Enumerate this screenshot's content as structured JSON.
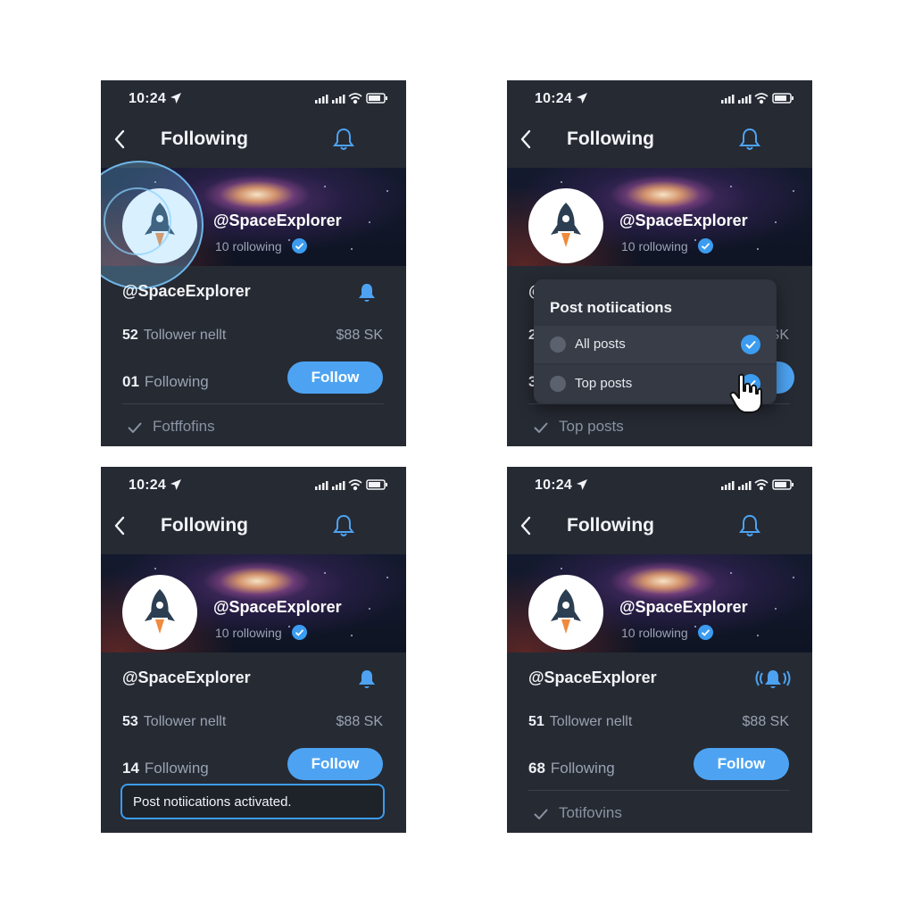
{
  "colors": {
    "accent": "#4da3f2",
    "background": "#262a33",
    "text_muted": "#9aa3b2"
  },
  "status": {
    "time": "10:24"
  },
  "nav": {
    "title": "Following"
  },
  "profile": {
    "handle": "@SpaceExplorer",
    "following_sub": "10 rollowing"
  },
  "screens": [
    {
      "row_handle": "@SpaceExplorer",
      "stat1_num": "52",
      "stat1_label": "Tollower nellt",
      "stat_right": "$88 SK",
      "stat2_num": "01",
      "stat2_label": "Following",
      "follow": "Follow",
      "bottom_label": "Fotffofins"
    },
    {
      "bottom_label": "Top posts",
      "behind_stat1_num": "2",
      "behind_stat2_num": "3",
      "behind_stat_right": "SK",
      "dropdown": {
        "title": "Post notiications",
        "options": [
          "All posts",
          "Top posts"
        ]
      }
    },
    {
      "row_handle": "@SpaceExplorer",
      "stat1_num": "53",
      "stat1_label": "Tollower nellt",
      "stat_right": "$88 SK",
      "stat2_num": "14",
      "stat2_label": "Following",
      "follow": "Follow",
      "toast": "Post notiications activated."
    },
    {
      "row_handle": "@SpaceExplorer",
      "stat1_num": "51",
      "stat1_label": "Tollower nellt",
      "stat_right": "$88 SK",
      "stat2_num": "68",
      "stat2_label": "Following",
      "follow": "Follow",
      "bottom_label": "Totifovins"
    }
  ],
  "icons": [
    "location-arrow-icon",
    "signal-icon",
    "wifi-icon",
    "battery-icon",
    "back-chevron-icon",
    "bell-icon",
    "rocket-icon",
    "verified-icon",
    "check-icon",
    "cursor-hand-icon",
    "bell-ringing-icon"
  ]
}
